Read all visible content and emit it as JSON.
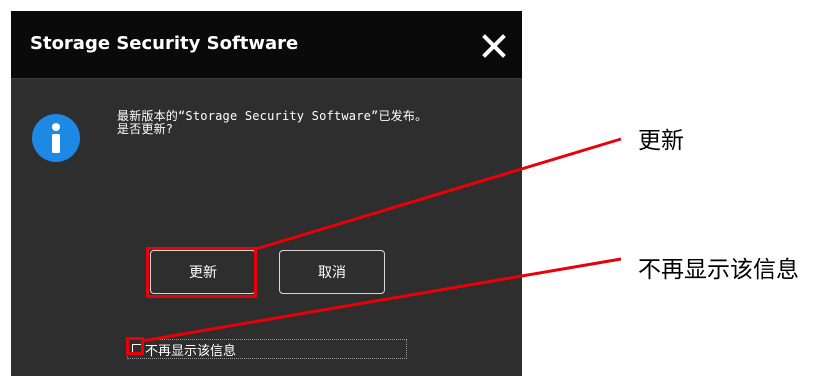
{
  "dialog": {
    "title": "Storage Security Software",
    "message_line1": "最新版本的“Storage Security Software”已发布。",
    "message_line2": "是否更新?",
    "buttons": {
      "update": "更新",
      "cancel": "取消"
    },
    "checkbox": {
      "label": "不再显示该信息",
      "checked": false
    }
  },
  "annotations": {
    "update_callout": "更新",
    "checkbox_callout": "不再显示该信息",
    "highlight_color": "#e8000a"
  },
  "colors": {
    "dialog_bg": "#2e2e2e",
    "titlebar_bg": "#0a0a0a",
    "info_icon": "#1e88e5"
  },
  "icons": {
    "close": "close-icon",
    "info": "info-icon"
  }
}
